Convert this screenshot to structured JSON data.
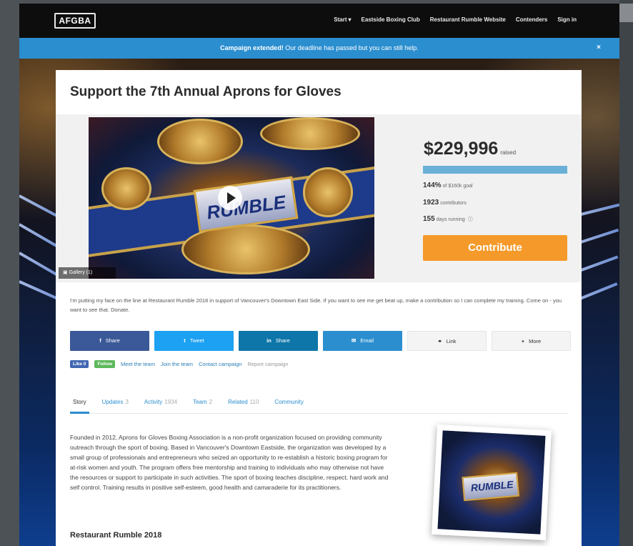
{
  "nav": {
    "logo": "AFGBA",
    "links": [
      "Start",
      "Eastside Boxing Club",
      "Restaurant Rumble Website",
      "Contenders",
      "Sign in"
    ]
  },
  "banner": {
    "bold": "Campaign extended!",
    "text": " Our deadline has passed but you can still help.",
    "close": "×"
  },
  "campaign": {
    "title": "Support the 7th Annual Aprons for Gloves",
    "video_plate_text": "RUMBLE",
    "gallery_label": "Gallery (1)"
  },
  "stats": {
    "raised_amount": "$229,996",
    "raised_label": "raised",
    "progress_fraction": 1.0,
    "percent_value": "144%",
    "percent_label": "of $160k goal",
    "contributors_value": "1923",
    "contributors_label": "contributors",
    "days_value": "155",
    "days_label": "days running",
    "contribute_button": "Contribute"
  },
  "pitch": "I'm putting my face on the line at Restaurant Rumble 2018 in support of Vancouver's Downtown East Side. If you want to see me get beat up, make a contribution so I can complete my training. Come on - you want to see that. Donate.",
  "share_buttons": [
    {
      "icon": "f",
      "label": "Share",
      "color": "#3b5998",
      "name": "facebook-share-button",
      "icon_name": "facebook-icon"
    },
    {
      "icon": "t",
      "label": "Tweet",
      "color": "#1da1f2",
      "name": "twitter-tweet-button",
      "icon_name": "twitter-icon"
    },
    {
      "icon": "in",
      "label": "Share",
      "color": "#0e76a8",
      "name": "linkedin-share-button",
      "icon_name": "linkedin-icon"
    },
    {
      "icon": "✉",
      "label": "Email",
      "color": "#2b8ecf",
      "name": "email-share-button",
      "icon_name": "mail-icon"
    },
    {
      "icon": "⚭",
      "label": "Link",
      "color": "#f4f4f4",
      "name": "link-share-button",
      "icon_name": "link-icon"
    },
    {
      "icon": "+",
      "label": "More",
      "color": "#f4f4f4",
      "name": "more-share-button",
      "icon_name": "plus-icon"
    }
  ],
  "social": {
    "like": "Like 0",
    "follow": "Follow",
    "links": [
      "Meet the team",
      "Join the team",
      "Contact campaign"
    ],
    "report": "Report campaign"
  },
  "tabs": [
    {
      "label": "Story",
      "count": ""
    },
    {
      "label": "Updates",
      "count": "3"
    },
    {
      "label": "Activity",
      "count": "1934"
    },
    {
      "label": "Team",
      "count": "2"
    },
    {
      "label": "Related",
      "count": "110"
    },
    {
      "label": "Community",
      "count": ""
    }
  ],
  "story": {
    "body": "Founded in 2012, Aprons for Gloves Boxing Association is a non-profit organization focused on providing community outreach through the sport of boxing. Based in Vancouver's Downtown Eastside, the organization was developed by a small group of professionals and entrepreneurs who seized an opportunity to re-establish a historic boxing program for at-risk women and youth. The program offers free mentorship and training to individuals who may otherwise not have the resources or support to participate in such activities. The sport of boxing teaches discipline, respect, hard work and self control. Training results in positive self-esteem, good health and camaraderie for its practitioners.",
    "heading": "Restaurant Rumble 2018",
    "photo_plate_text": "RUMBLE"
  },
  "colors": {
    "banner": "#2b8ecf",
    "accent": "#f59a2a",
    "progress": "#6ab0d6"
  }
}
